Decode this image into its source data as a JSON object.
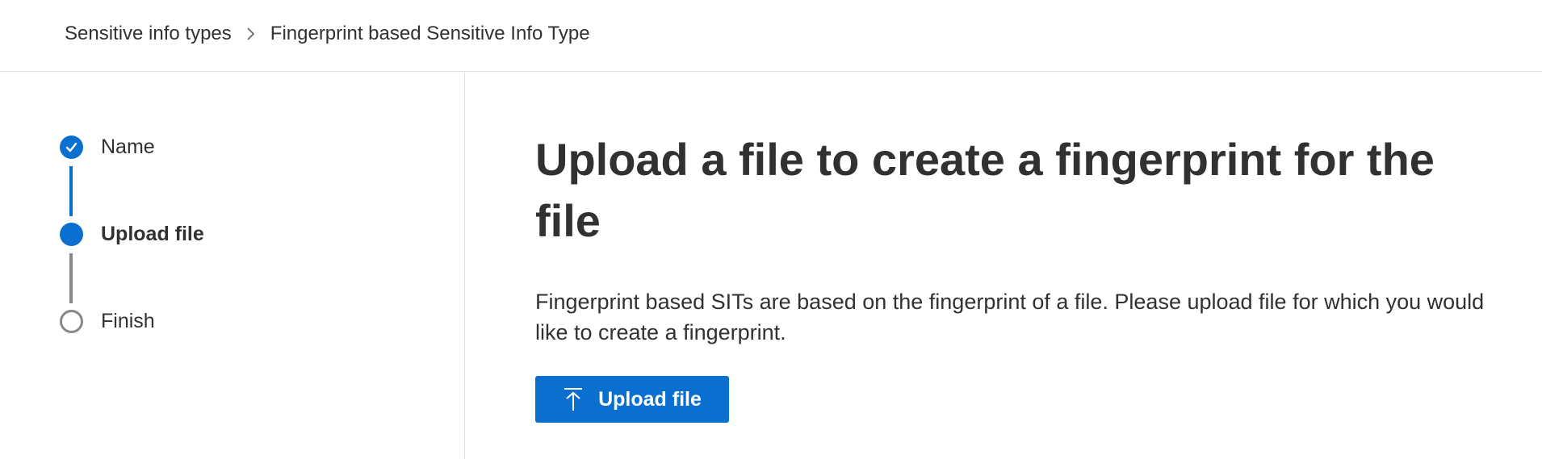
{
  "breadcrumb": {
    "items": [
      {
        "label": "Sensitive info types"
      },
      {
        "label": "Fingerprint based Sensitive Info Type"
      }
    ],
    "separator_icon": "chevron-right-icon"
  },
  "wizard": {
    "steps": [
      {
        "label": "Name",
        "state": "complete",
        "icon": "checkmark-icon"
      },
      {
        "label": "Upload file",
        "state": "current"
      },
      {
        "label": "Finish",
        "state": "pending"
      }
    ]
  },
  "main": {
    "title": "Upload a file to create a fingerprint for the file",
    "description": "Fingerprint based SITs are based on the fingerprint of a file. Please upload file for which you would like to create a fingerprint.",
    "upload_button": {
      "label": "Upload file",
      "icon": "upload-icon"
    }
  },
  "colors": {
    "accent": "#0B6FD0",
    "text": "#323130",
    "pending": "#8A8886",
    "divider": "#E1DFDD"
  }
}
